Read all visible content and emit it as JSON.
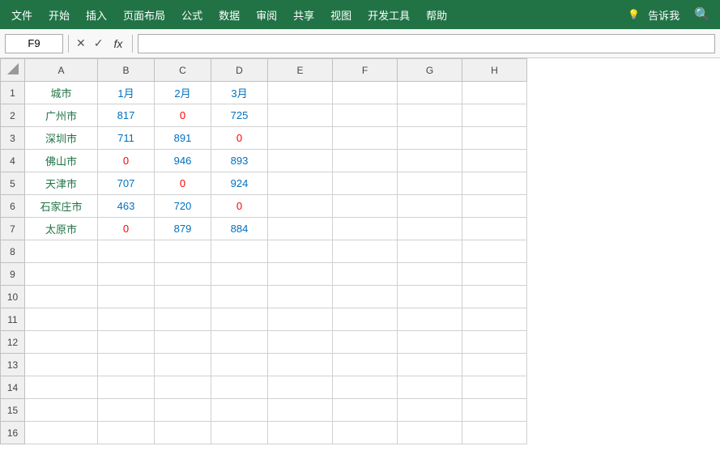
{
  "menubar": {
    "items": [
      "文件",
      "开始",
      "插入",
      "页面布局",
      "公式",
      "数据",
      "审阅",
      "共享",
      "视图",
      "开发工具",
      "帮助",
      "告诉我"
    ],
    "bg_color": "#217346"
  },
  "formulabar": {
    "cell_ref": "F9",
    "cancel_icon": "✕",
    "confirm_icon": "✓",
    "fx_label": "fx",
    "formula_value": ""
  },
  "spreadsheet": {
    "col_headers": [
      "A",
      "B",
      "C",
      "D",
      "E",
      "F",
      "G",
      "H"
    ],
    "rows": [
      {
        "row": 1,
        "cells": [
          {
            "val": "城市",
            "color": "green"
          },
          {
            "val": "1月",
            "color": "blue"
          },
          {
            "val": "2月",
            "color": "blue"
          },
          {
            "val": "3月",
            "color": "blue"
          },
          {
            "val": ""
          },
          {
            "val": ""
          },
          {
            "val": ""
          },
          {
            "val": ""
          }
        ]
      },
      {
        "row": 2,
        "cells": [
          {
            "val": "广州市",
            "color": "green"
          },
          {
            "val": "817",
            "color": "blue"
          },
          {
            "val": "0",
            "color": "red"
          },
          {
            "val": "725",
            "color": "blue"
          },
          {
            "val": ""
          },
          {
            "val": ""
          },
          {
            "val": ""
          },
          {
            "val": ""
          }
        ]
      },
      {
        "row": 3,
        "cells": [
          {
            "val": "深圳市",
            "color": "green"
          },
          {
            "val": "711",
            "color": "blue"
          },
          {
            "val": "891",
            "color": "blue"
          },
          {
            "val": "0",
            "color": "red"
          },
          {
            "val": ""
          },
          {
            "val": ""
          },
          {
            "val": ""
          },
          {
            "val": ""
          }
        ]
      },
      {
        "row": 4,
        "cells": [
          {
            "val": "佛山市",
            "color": "green"
          },
          {
            "val": "0",
            "color": "red"
          },
          {
            "val": "946",
            "color": "blue"
          },
          {
            "val": "893",
            "color": "blue"
          },
          {
            "val": ""
          },
          {
            "val": ""
          },
          {
            "val": ""
          },
          {
            "val": ""
          }
        ]
      },
      {
        "row": 5,
        "cells": [
          {
            "val": "天津市",
            "color": "green"
          },
          {
            "val": "707",
            "color": "blue"
          },
          {
            "val": "0",
            "color": "red"
          },
          {
            "val": "924",
            "color": "blue"
          },
          {
            "val": ""
          },
          {
            "val": ""
          },
          {
            "val": ""
          },
          {
            "val": ""
          }
        ]
      },
      {
        "row": 6,
        "cells": [
          {
            "val": "石家庄市",
            "color": "green"
          },
          {
            "val": "463",
            "color": "blue"
          },
          {
            "val": "720",
            "color": "blue"
          },
          {
            "val": "0",
            "color": "red"
          },
          {
            "val": ""
          },
          {
            "val": ""
          },
          {
            "val": ""
          },
          {
            "val": ""
          }
        ]
      },
      {
        "row": 7,
        "cells": [
          {
            "val": "太原市",
            "color": "green"
          },
          {
            "val": "0",
            "color": "red"
          },
          {
            "val": "879",
            "color": "blue"
          },
          {
            "val": "884",
            "color": "blue"
          },
          {
            "val": ""
          },
          {
            "val": ""
          },
          {
            "val": ""
          },
          {
            "val": ""
          }
        ]
      },
      {
        "row": 8,
        "cells": [
          {
            "val": ""
          },
          {
            "val": ""
          },
          {
            "val": ""
          },
          {
            "val": ""
          },
          {
            "val": ""
          },
          {
            "val": ""
          },
          {
            "val": ""
          },
          {
            "val": ""
          }
        ]
      },
      {
        "row": 9,
        "cells": [
          {
            "val": ""
          },
          {
            "val": ""
          },
          {
            "val": ""
          },
          {
            "val": ""
          },
          {
            "val": ""
          },
          {
            "val": ""
          },
          {
            "val": ""
          },
          {
            "val": ""
          }
        ]
      },
      {
        "row": 10,
        "cells": [
          {
            "val": ""
          },
          {
            "val": ""
          },
          {
            "val": ""
          },
          {
            "val": ""
          },
          {
            "val": ""
          },
          {
            "val": ""
          },
          {
            "val": ""
          },
          {
            "val": ""
          }
        ]
      },
      {
        "row": 11,
        "cells": [
          {
            "val": ""
          },
          {
            "val": ""
          },
          {
            "val": ""
          },
          {
            "val": ""
          },
          {
            "val": ""
          },
          {
            "val": ""
          },
          {
            "val": ""
          },
          {
            "val": ""
          }
        ]
      },
      {
        "row": 12,
        "cells": [
          {
            "val": ""
          },
          {
            "val": ""
          },
          {
            "val": ""
          },
          {
            "val": ""
          },
          {
            "val": ""
          },
          {
            "val": ""
          },
          {
            "val": ""
          },
          {
            "val": ""
          }
        ]
      },
      {
        "row": 13,
        "cells": [
          {
            "val": ""
          },
          {
            "val": ""
          },
          {
            "val": ""
          },
          {
            "val": ""
          },
          {
            "val": ""
          },
          {
            "val": ""
          },
          {
            "val": ""
          },
          {
            "val": ""
          }
        ]
      },
      {
        "row": 14,
        "cells": [
          {
            "val": ""
          },
          {
            "val": ""
          },
          {
            "val": ""
          },
          {
            "val": ""
          },
          {
            "val": ""
          },
          {
            "val": ""
          },
          {
            "val": ""
          },
          {
            "val": ""
          }
        ]
      },
      {
        "row": 15,
        "cells": [
          {
            "val": ""
          },
          {
            "val": ""
          },
          {
            "val": ""
          },
          {
            "val": ""
          },
          {
            "val": ""
          },
          {
            "val": ""
          },
          {
            "val": ""
          },
          {
            "val": ""
          }
        ]
      },
      {
        "row": 16,
        "cells": [
          {
            "val": ""
          },
          {
            "val": ""
          },
          {
            "val": ""
          },
          {
            "val": ""
          },
          {
            "val": ""
          },
          {
            "val": ""
          },
          {
            "val": ""
          },
          {
            "val": ""
          }
        ]
      }
    ]
  }
}
